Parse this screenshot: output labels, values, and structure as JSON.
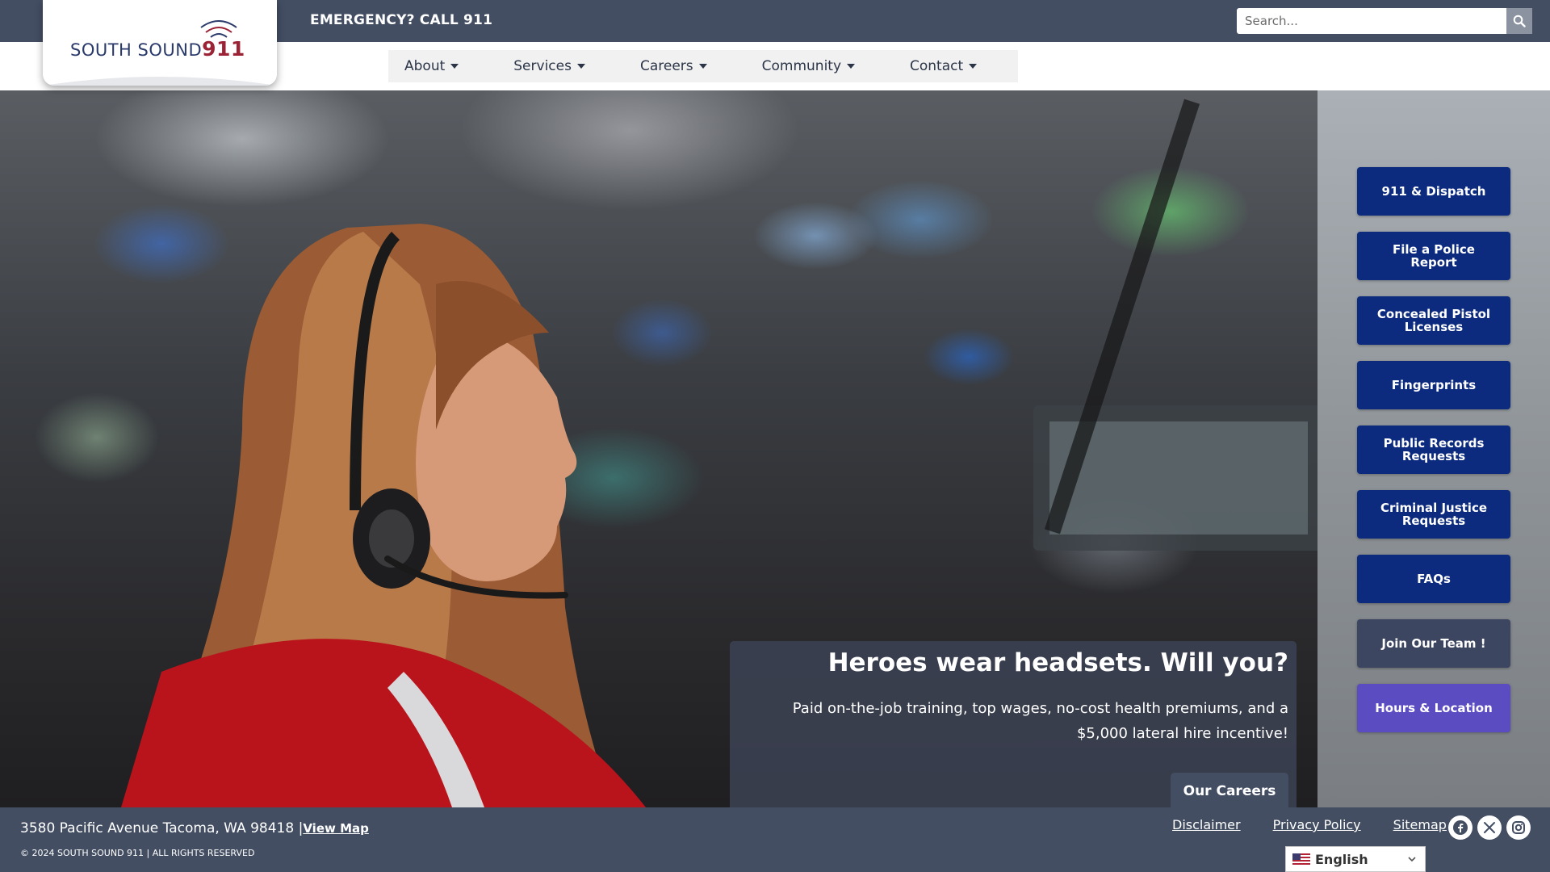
{
  "header": {
    "emergency_text": "EMERGENCY? CALL 911",
    "search_placeholder": "Search...",
    "search_icon": "search-icon"
  },
  "logo": {
    "text_main": "SOUTH SOUND",
    "text_number": "911"
  },
  "nav": {
    "items": [
      {
        "label": "About"
      },
      {
        "label": "Services"
      },
      {
        "label": "Careers"
      },
      {
        "label": "Community"
      },
      {
        "label": "Contact"
      }
    ]
  },
  "hero": {
    "title": "Heroes wear headsets. Will you?",
    "text": "Paid on-the-job training, top wages, no-cost health premiums, and a $5,000 lateral hire incentive!",
    "button": "Our Careers"
  },
  "quick_links": [
    {
      "label": "911 & Dispatch",
      "color": "#0d2b7e"
    },
    {
      "label": "File a Police Report",
      "color": "#0d2b7e"
    },
    {
      "label": "Concealed Pistol Licenses",
      "color": "#0d2b7e"
    },
    {
      "label": "Fingerprints",
      "color": "#0d2b7e"
    },
    {
      "label": "Public Records Requests",
      "color": "#0d2b7e"
    },
    {
      "label": "Criminal Justice Requests",
      "color": "#0d2b7e"
    },
    {
      "label": "FAQs",
      "color": "#0d2b7e"
    },
    {
      "label": "Join Our Team !",
      "color": "#3d4660"
    },
    {
      "label": "Hours & Location",
      "color": "#5b4cc2"
    }
  ],
  "footer": {
    "address": "3580 Pacific Avenue Tacoma, WA 98418",
    "separator": "|",
    "map_link": "View Map",
    "copyright": "© 2024 SOUTH SOUND 911 | ALL RIGHTS RESERVED",
    "links": [
      {
        "label": "Disclaimer"
      },
      {
        "label": "Privacy Policy"
      },
      {
        "label": "Sitemap"
      }
    ],
    "socials": [
      "facebook-icon",
      "x-icon",
      "instagram-icon"
    ],
    "language": "English"
  },
  "colors": {
    "header_bg": "#434e63",
    "quick_link_blue": "#0d2b7e",
    "quick_link_gray": "#3d4660",
    "quick_link_purple": "#5b4cc2",
    "logo_red": "#9b2335",
    "logo_navy": "#2a3a6a"
  }
}
